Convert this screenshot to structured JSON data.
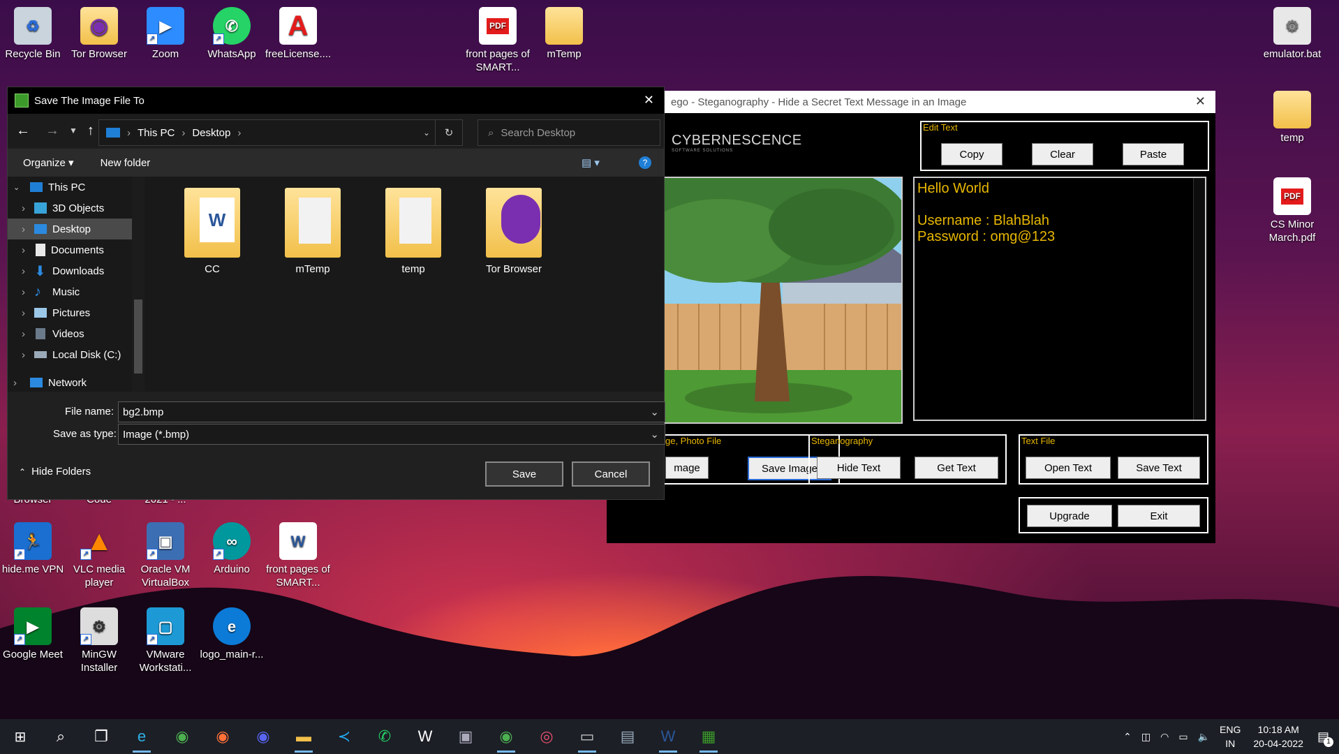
{
  "desktop": {
    "top_icons": [
      {
        "label": "Recycle Bin",
        "icon": "recycle-bin-icon"
      },
      {
        "label": "Tor Browser",
        "icon": "tor-browser-icon"
      },
      {
        "label": "Zoom",
        "icon": "zoom-icon"
      },
      {
        "label": "WhatsApp",
        "icon": "whatsapp-icon"
      },
      {
        "label": "freeLicense....",
        "icon": "acrobat-icon"
      },
      {
        "label": "front pages of SMART...",
        "icon": "pdf-icon"
      },
      {
        "label": "mTemp",
        "icon": "folder-icon"
      },
      {
        "label": "emulator.bat",
        "icon": "bat-file-icon"
      }
    ],
    "right_icons": [
      {
        "label": "temp",
        "icon": "folder-icon"
      },
      {
        "label": "CS Minor March.pdf",
        "icon": "pdf-icon"
      }
    ],
    "partial_labels": [
      "Browser",
      "Code",
      "2021 - ..."
    ],
    "row2_icons": [
      {
        "label": "hide.me VPN",
        "icon": "vpn-icon"
      },
      {
        "label": "VLC media player",
        "icon": "vlc-icon"
      },
      {
        "label": "Oracle VM VirtualBox",
        "icon": "virtualbox-icon"
      },
      {
        "label": "Arduino",
        "icon": "arduino-icon"
      },
      {
        "label": "front pages of SMART...",
        "icon": "word-doc-icon"
      }
    ],
    "row3_icons": [
      {
        "label": "Google Meet",
        "icon": "google-meet-icon"
      },
      {
        "label": "MinGW Installer",
        "icon": "mingw-icon"
      },
      {
        "label": "VMware Workstati...",
        "icon": "vmware-icon"
      },
      {
        "label": "logo_main-r...",
        "icon": "edge-icon"
      }
    ],
    "pdf_badge": "PDF"
  },
  "dialog": {
    "title": "Save The Image File To",
    "breadcrumb": [
      "This PC",
      "Desktop"
    ],
    "search_placeholder": "Search Desktop",
    "organize": "Organize",
    "new_folder": "New folder",
    "help": "?",
    "nav_items": [
      "This PC",
      "3D Objects",
      "Desktop",
      "Documents",
      "Downloads",
      "Music",
      "Pictures",
      "Videos",
      "Local Disk (C:)",
      "Network"
    ],
    "files": [
      "CC",
      "mTemp",
      "temp",
      "Tor Browser"
    ],
    "file_name_label": "File name:",
    "file_name_value": "bg2.bmp",
    "save_type_label": "Save as type:",
    "save_type_value": "Image (*.bmp)",
    "hide_folders": "Hide Folders",
    "save": "Save",
    "cancel": "Cancel"
  },
  "app": {
    "title": "ego - Steganography - Hide a Secret Text Message in an Image",
    "brand": "CYBERNESCENCE",
    "brand_sub": "SOFTWARE SOLUTIONS",
    "edit_text_legend": "Edit Text",
    "copy": "Copy",
    "clear": "Clear",
    "paste": "Paste",
    "text_lines": [
      "Hello World",
      "",
      "Username : BlahBlah",
      "Password : omg@123"
    ],
    "image_legend": "ge, Photo File",
    "open_image": "mage",
    "save_image": "Save Image",
    "steg_legend": "Steganography",
    "hide_text": "Hide Text",
    "get_text": "Get Text",
    "textfile_legend": "Text File",
    "open_text": "Open Text",
    "save_text": "Save Text",
    "upgrade": "Upgrade",
    "exit": "Exit"
  },
  "tray": {
    "lang": "ENG",
    "region": "IN",
    "time": "10:18 AM",
    "date": "20-04-2022",
    "notifications": "1"
  },
  "colors": {
    "accent": "#e8b700",
    "taskbar": "#1c1f26",
    "dialog": "#202020"
  }
}
